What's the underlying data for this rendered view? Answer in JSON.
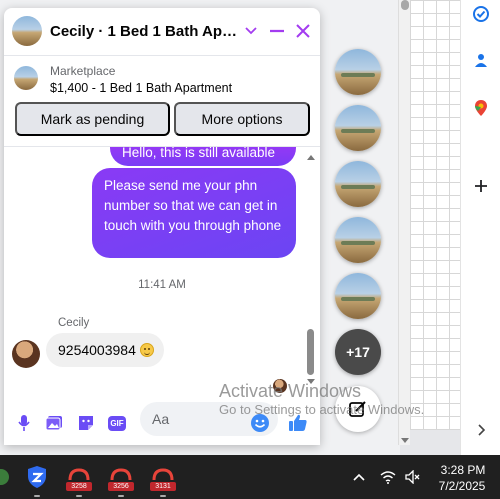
{
  "chat": {
    "title": "Cecily · 1 Bed 1 Bath Apart…",
    "listing": {
      "source": "Marketplace",
      "title": "$1,400 - 1 Bed 1 Bath Apartment",
      "mark_pending_label": "Mark as pending",
      "more_options_label": "More options"
    },
    "messages": [
      {
        "direction": "outgoing",
        "text": "Hello, this is still available"
      },
      {
        "direction": "outgoing",
        "text": "Please send me your phn number so that we can get in touch with you through phone"
      },
      {
        "direction": "incoming",
        "text": "9254003984"
      }
    ],
    "timestamp": "11:41 AM",
    "sender_name": "Cecily",
    "composer": {
      "placeholder": "Aa",
      "icons": [
        "microphone-icon",
        "image-icon",
        "sticker-icon",
        "gif-icon",
        "emoji-icon",
        "thumbs-up-icon"
      ],
      "gif_label": "GIF"
    }
  },
  "bubbles": {
    "more_count": "+17",
    "icons": [
      "chat-head-avatar",
      "compose-icon"
    ]
  },
  "watermark": {
    "title": "Activate Windows",
    "subtitle": "Go to Settings to activate Windows."
  },
  "taskbar": {
    "apps": [
      {
        "name": "app-shield-icon",
        "badge": ""
      },
      {
        "name": "app-icon",
        "badge": "3258"
      },
      {
        "name": "app-icon",
        "badge": "3256"
      },
      {
        "name": "app-icon",
        "badge": "3131"
      }
    ],
    "time": "3:28 PM",
    "date": "7/2/2025"
  },
  "colors": {
    "accent": "#a33cf0",
    "outgoing_bubble": "#7a3cf5",
    "taskbar": "#202020"
  }
}
